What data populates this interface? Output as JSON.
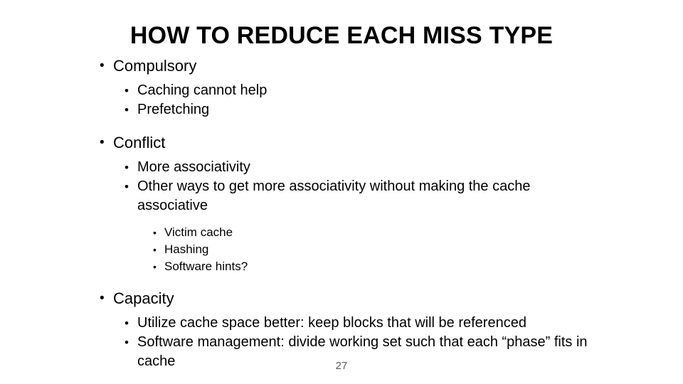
{
  "slide": {
    "title": "HOW TO REDUCE EACH MISS TYPE",
    "page_number": "27",
    "text_color": "#000000",
    "page_number_color": "#5a5a5a",
    "background_color": "#ffffff",
    "bullet_glyph": "•",
    "sections": [
      {
        "heading": "Compulsory",
        "sub_bullets": [
          {
            "text": "Caching cannot help"
          },
          {
            "text": "Prefetching"
          }
        ]
      },
      {
        "heading": "Conflict",
        "sub_bullets": [
          {
            "text": "More associativity"
          },
          {
            "text": "Other ways to get more associativity without making the cache associative",
            "sub_sub_bullets": [
              {
                "text": "Victim cache"
              },
              {
                "text": "Hashing"
              },
              {
                "text": "Software hints?"
              }
            ]
          }
        ]
      },
      {
        "heading": "Capacity",
        "sub_bullets": [
          {
            "text": "Utilize cache space better: keep blocks that will be referenced"
          },
          {
            "text": "Software management: divide working set such that each “phase” fits in cache"
          }
        ]
      }
    ]
  }
}
